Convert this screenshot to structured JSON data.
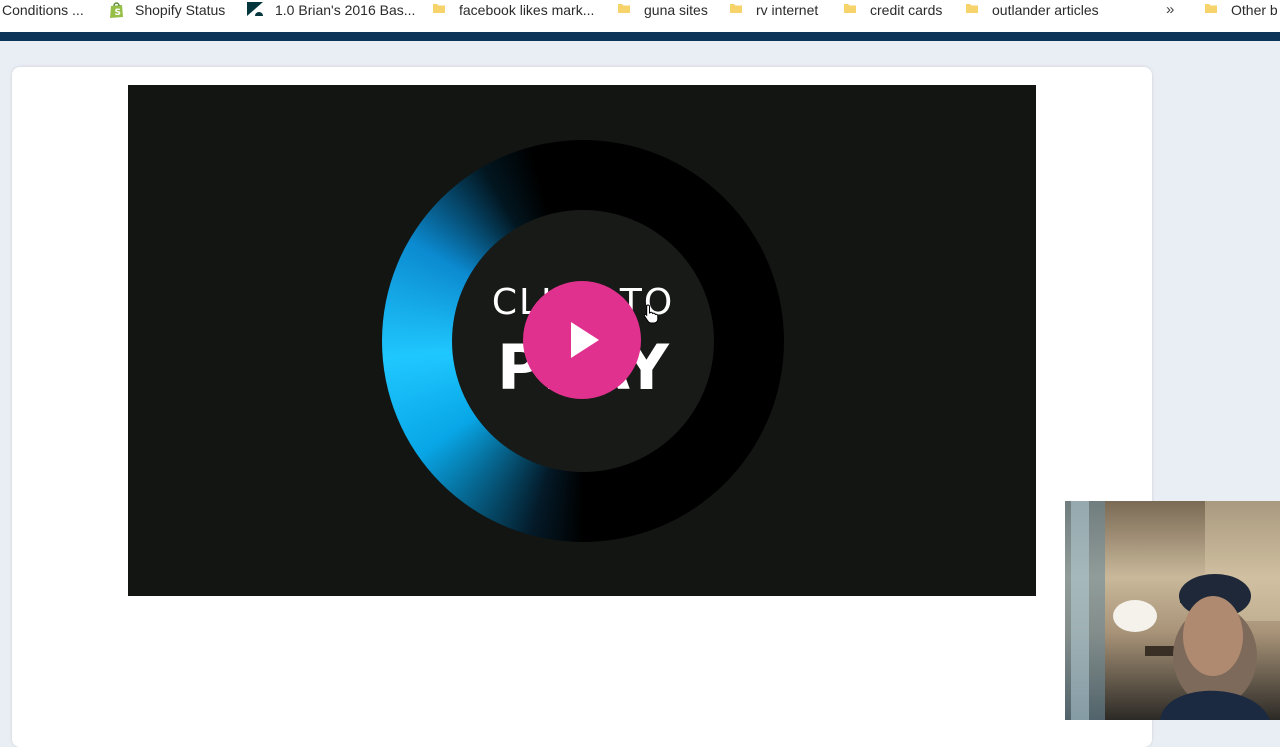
{
  "bookmarks": [
    {
      "label": "Conditions ...",
      "icon": "none"
    },
    {
      "label": "Shopify Status",
      "icon": "shopify-icon"
    },
    {
      "label": "1.0 Brian's 2016 Bas...",
      "icon": "zendesk-icon"
    },
    {
      "label": "facebook likes mark...",
      "icon": "folder-icon"
    },
    {
      "label": "guna sites",
      "icon": "folder-icon"
    },
    {
      "label": "rv internet",
      "icon": "folder-icon"
    },
    {
      "label": "credit cards",
      "icon": "folder-icon"
    },
    {
      "label": "outlander articles",
      "icon": "folder-icon"
    },
    {
      "label": "Other b",
      "icon": "folder-icon"
    }
  ],
  "overflow_chevron": "»",
  "video": {
    "text_top": "CLICK TO",
    "text_bottom": "PLAY"
  },
  "colors": {
    "navbar": "#0c3358",
    "play_button": "#e0318e",
    "ring_accent": "#1fc7ff",
    "folder": "#f6d36b"
  }
}
